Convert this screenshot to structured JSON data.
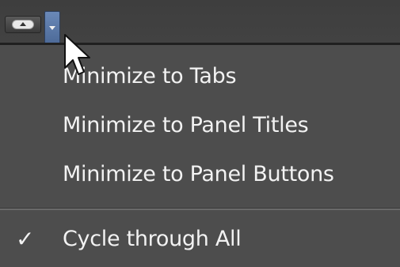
{
  "toolbar": {
    "minimize_button_icon": "minimize-pill-icon",
    "dropdown_icon": "chevron-down-icon",
    "accent_color": "#5a7aae"
  },
  "menu": {
    "items": [
      {
        "label": "Minimize to Tabs",
        "checked": false
      },
      {
        "label": "Minimize to Panel Titles",
        "checked": false
      },
      {
        "label": "Minimize to Panel Buttons",
        "checked": false
      },
      {
        "label": "Cycle through All",
        "checked": true
      }
    ],
    "check_glyph": "✓"
  }
}
